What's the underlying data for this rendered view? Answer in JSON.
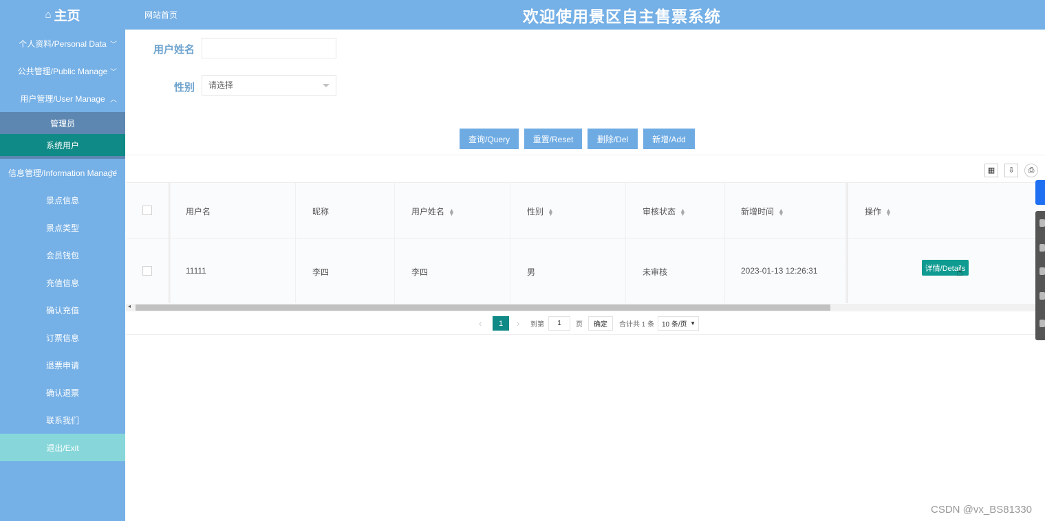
{
  "header": {
    "home_label": "主页",
    "site_link": "网站首页",
    "title": "欢迎使用景区自主售票系统"
  },
  "sidebar": {
    "groups": [
      {
        "label": "个人资料/Personal Data"
      },
      {
        "label": "公共管理/Public Manage"
      },
      {
        "label": "用户管理/User Manage"
      },
      {
        "label": "信息管理/Information Manage"
      }
    ],
    "user_subitems": [
      "管理员",
      "系统用户"
    ],
    "info_subitems": [
      "景点信息",
      "景点类型",
      "会员钱包",
      "充值信息",
      "确认充值",
      "订票信息",
      "退票申请",
      "确认退票",
      "联系我们"
    ],
    "exit_label": "退出/Exit"
  },
  "search": {
    "name_label": "用户姓名",
    "name_value": "",
    "gender_label": "性别",
    "gender_placeholder": "请选择"
  },
  "buttons": {
    "query": "查询/Query",
    "reset": "重置/Reset",
    "delete": "删除/Del",
    "add": "新增/Add"
  },
  "table": {
    "columns": [
      "用户名",
      "昵称",
      "用户姓名",
      "性别",
      "审核状态",
      "新增时间",
      "操作"
    ],
    "rows": [
      {
        "username": "11111",
        "nickname": "李四",
        "realname": "李四",
        "gender": "男",
        "status": "未审核",
        "created": "2023-01-13 12:26:31",
        "action": "详情/Details"
      }
    ]
  },
  "pager": {
    "current_page": "1",
    "goto_label": "到第",
    "goto_value": "1",
    "page_unit": "页",
    "confirm_label": "确定",
    "total_label": "合计共 1 条",
    "page_size": "10 条/页"
  },
  "watermark": "CSDN @vx_BS81330"
}
